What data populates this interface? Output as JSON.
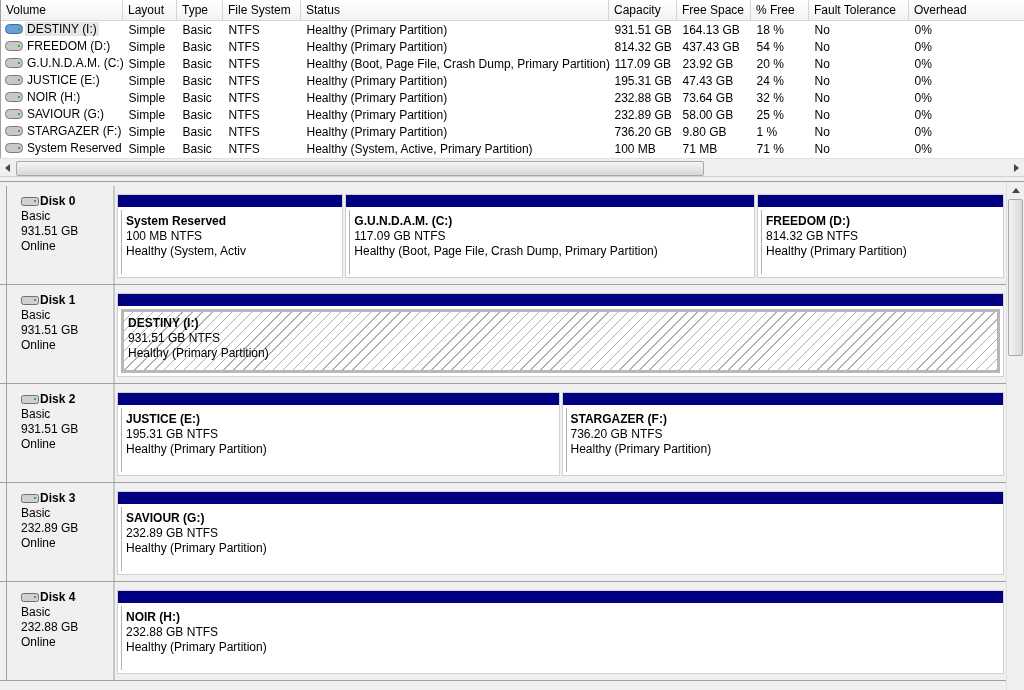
{
  "volume_table": {
    "columns": [
      "Volume",
      "Layout",
      "Type",
      "File System",
      "Status",
      "Capacity",
      "Free Space",
      "% Free",
      "Fault Tolerance",
      "Overhead"
    ],
    "rows": [
      {
        "cells": [
          "DESTINY (I:)",
          "Simple",
          "Basic",
          "NTFS",
          "Healthy (Primary Partition)",
          "931.51 GB",
          "164.13 GB",
          "18 %",
          "No",
          "0%"
        ],
        "selected": true
      },
      {
        "cells": [
          "FREEDOM (D:)",
          "Simple",
          "Basic",
          "NTFS",
          "Healthy (Primary Partition)",
          "814.32 GB",
          "437.43 GB",
          "54 %",
          "No",
          "0%"
        ],
        "selected": false
      },
      {
        "cells": [
          "G.U.N.D.A.M. (C:)",
          "Simple",
          "Basic",
          "NTFS",
          "Healthy (Boot, Page File, Crash Dump, Primary Partition)",
          "117.09 GB",
          "23.92 GB",
          "20 %",
          "No",
          "0%"
        ],
        "selected": false
      },
      {
        "cells": [
          "JUSTICE (E:)",
          "Simple",
          "Basic",
          "NTFS",
          "Healthy (Primary Partition)",
          "195.31 GB",
          "47.43 GB",
          "24 %",
          "No",
          "0%"
        ],
        "selected": false
      },
      {
        "cells": [
          "NOIR (H:)",
          "Simple",
          "Basic",
          "NTFS",
          "Healthy (Primary Partition)",
          "232.88 GB",
          "73.64 GB",
          "32 %",
          "No",
          "0%"
        ],
        "selected": false
      },
      {
        "cells": [
          "SAVIOUR (G:)",
          "Simple",
          "Basic",
          "NTFS",
          "Healthy (Primary Partition)",
          "232.89 GB",
          "58.00 GB",
          "25 %",
          "No",
          "0%"
        ],
        "selected": false
      },
      {
        "cells": [
          "STARGAZER (F:)",
          "Simple",
          "Basic",
          "NTFS",
          "Healthy (Primary Partition)",
          "736.20 GB",
          "9.80 GB",
          "1 %",
          "No",
          "0%"
        ],
        "selected": false
      },
      {
        "cells": [
          "System Reserved",
          "Simple",
          "Basic",
          "NTFS",
          "Healthy (System, Active, Primary Partition)",
          "100 MB",
          "71 MB",
          "71 %",
          "No",
          "0%"
        ],
        "selected": false
      }
    ]
  },
  "disks": [
    {
      "name": "Disk 0",
      "type": "Basic",
      "size": "931.51 GB",
      "status": "Online",
      "partitions": [
        {
          "name": "System Reserved",
          "size": "100 MB NTFS",
          "status": "Healthy (System, Activ",
          "selected": false
        },
        {
          "name": "G.U.N.D.A.M.  (C:)",
          "size": "117.09 GB NTFS",
          "status": "Healthy (Boot, Page File, Crash Dump, Primary Partition)",
          "selected": false
        },
        {
          "name": "FREEDOM  (D:)",
          "size": "814.32 GB NTFS",
          "status": "Healthy (Primary Partition)",
          "selected": false
        }
      ]
    },
    {
      "name": "Disk 1",
      "type": "Basic",
      "size": "931.51 GB",
      "status": "Online",
      "partitions": [
        {
          "name": "DESTINY  (I:)",
          "size": "931.51 GB NTFS",
          "status": "Healthy (Primary Partition)",
          "selected": true
        }
      ]
    },
    {
      "name": "Disk 2",
      "type": "Basic",
      "size": "931.51 GB",
      "status": "Online",
      "partitions": [
        {
          "name": "JUSTICE  (E:)",
          "size": "195.31 GB NTFS",
          "status": "Healthy (Primary Partition)",
          "selected": false
        },
        {
          "name": "STARGAZER  (F:)",
          "size": "736.20 GB NTFS",
          "status": "Healthy (Primary Partition)",
          "selected": false
        }
      ]
    },
    {
      "name": "Disk 3",
      "type": "Basic",
      "size": "232.89 GB",
      "status": "Online",
      "partitions": [
        {
          "name": "SAVIOUR  (G:)",
          "size": "232.89 GB NTFS",
          "status": "Healthy (Primary Partition)",
          "selected": false
        }
      ]
    },
    {
      "name": "Disk 4",
      "type": "Basic",
      "size": "232.88 GB",
      "status": "Online",
      "partitions": [
        {
          "name": "NOIR  (H:)",
          "size": "232.88 GB NTFS",
          "status": "Healthy (Primary Partition)",
          "selected": false
        }
      ]
    }
  ]
}
